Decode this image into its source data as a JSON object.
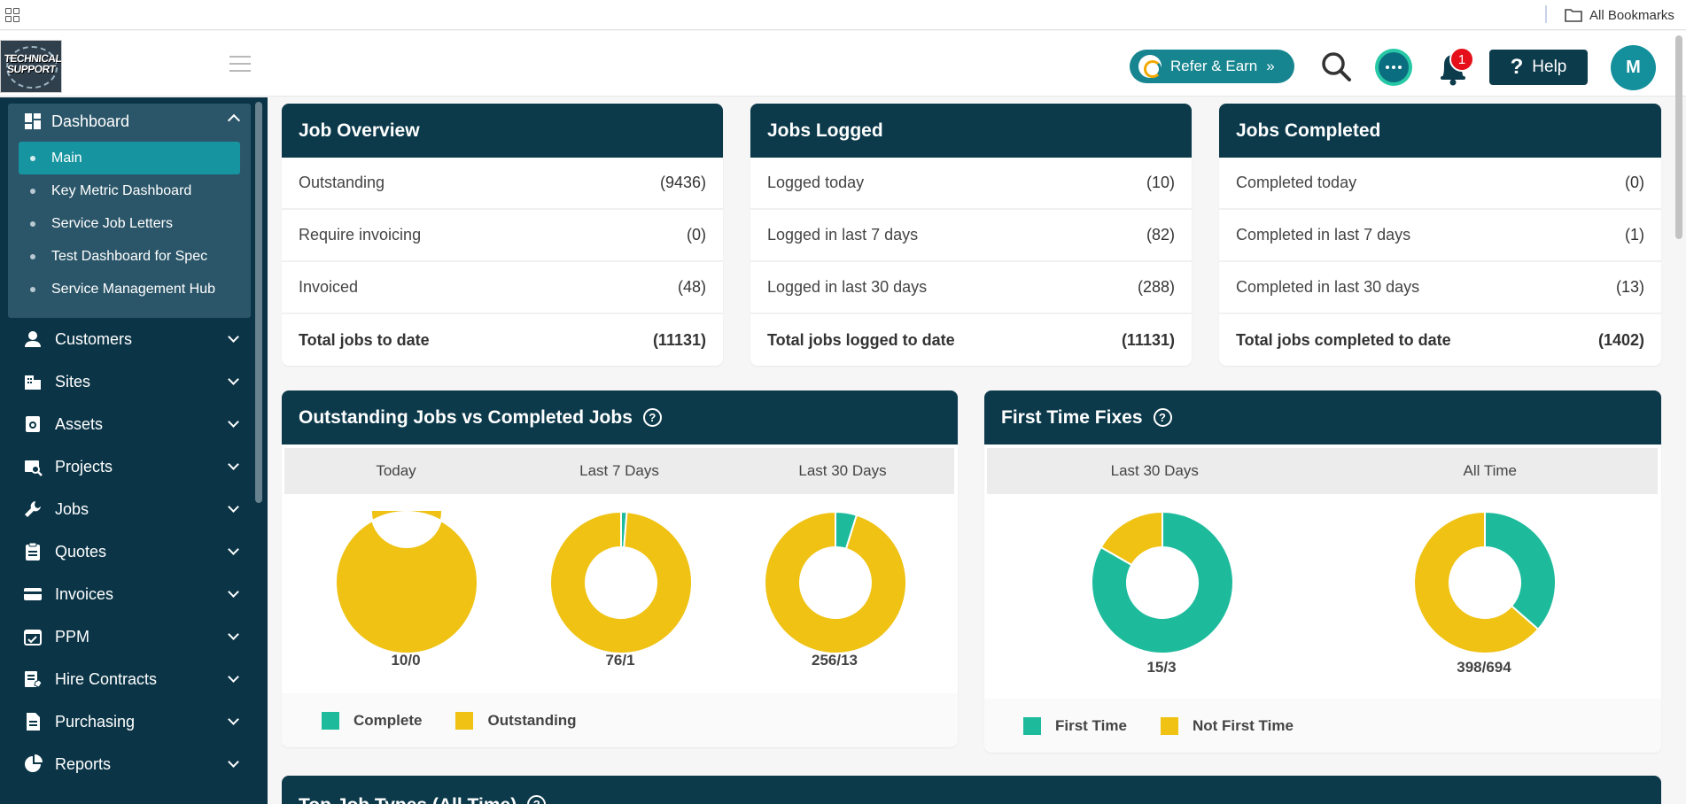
{
  "bookmarks_bar": {
    "folder_label": "All Bookmarks"
  },
  "logo": {
    "line1": "TECHNICAL",
    "line2": "SUPPORT"
  },
  "topbar": {
    "refer_label": "Refer & Earn",
    "refer_chevrons": "»",
    "notification_count": "1",
    "help_label": "Help",
    "help_symbol": "?",
    "avatar_initial": "M"
  },
  "sidebar": {
    "dashboard_label": "Dashboard",
    "dashboard_items": [
      {
        "label": "Main",
        "active": true
      },
      {
        "label": "Key Metric Dashboard"
      },
      {
        "label": "Service Job Letters"
      },
      {
        "label": "Test Dashboard for Spec"
      },
      {
        "label": "Service Management Hub"
      }
    ],
    "nav_items": [
      {
        "label": "Customers",
        "icon": "person-icon"
      },
      {
        "label": "Sites",
        "icon": "building-icon"
      },
      {
        "label": "Assets",
        "icon": "asset-icon"
      },
      {
        "label": "Projects",
        "icon": "projects-icon"
      },
      {
        "label": "Jobs",
        "icon": "wrench-icon"
      },
      {
        "label": "Quotes",
        "icon": "clipboard-icon"
      },
      {
        "label": "Invoices",
        "icon": "card-icon"
      },
      {
        "label": "PPM",
        "icon": "calendar-check-icon"
      },
      {
        "label": "Hire Contracts",
        "icon": "hire-contract-icon"
      },
      {
        "label": "Purchasing",
        "icon": "document-icon"
      },
      {
        "label": "Reports",
        "icon": "pie-chart-icon"
      }
    ]
  },
  "job_overview": {
    "title": "Job Overview",
    "rows": [
      {
        "label": "Outstanding",
        "value": "(9436)"
      },
      {
        "label": "Require invoicing",
        "value": "(0)"
      },
      {
        "label": "Invoiced",
        "value": "(48)"
      }
    ],
    "total": {
      "label": "Total jobs to date",
      "value": "(11131)"
    }
  },
  "jobs_logged": {
    "title": "Jobs Logged",
    "rows": [
      {
        "label": "Logged today",
        "value": "(10)"
      },
      {
        "label": "Logged in last 7 days",
        "value": "(82)"
      },
      {
        "label": "Logged in last 30 days",
        "value": "(288)"
      }
    ],
    "total": {
      "label": "Total jobs logged to date",
      "value": "(11131)"
    }
  },
  "jobs_completed": {
    "title": "Jobs Completed",
    "rows": [
      {
        "label": "Completed today",
        "value": "(0)"
      },
      {
        "label": "Completed in last 7 days",
        "value": "(1)"
      },
      {
        "label": "Completed in last 30 days",
        "value": "(13)"
      }
    ],
    "total": {
      "label": "Total jobs completed to date",
      "value": "(1402)"
    }
  },
  "outstanding_vs_completed": {
    "title": "Outstanding Jobs vs Completed Jobs",
    "periods": [
      "Today",
      "Last 7 Days",
      "Last 30 Days"
    ],
    "legend": [
      "Complete",
      "Outstanding"
    ]
  },
  "first_time_fixes": {
    "title": "First Time Fixes",
    "periods": [
      "Last 30 Days",
      "All Time"
    ],
    "legend": [
      "First Time",
      "Not First Time"
    ]
  },
  "bottom_card": {
    "title": "Top Job Types (All Time)"
  },
  "colors": {
    "complete": "#1dbb9c",
    "outstanding": "#efc214",
    "header": "#0c3a4b",
    "sidebar": "#0b3547",
    "accent": "#1694a0"
  },
  "chart_data": [
    {
      "type": "pie",
      "title": "Outstanding Jobs vs Completed Jobs",
      "subtitle": "Today",
      "labels": [
        "Complete",
        "Outstanding"
      ],
      "values": [
        0,
        10
      ],
      "caption": "10/0"
    },
    {
      "type": "pie",
      "title": "Outstanding Jobs vs Completed Jobs",
      "subtitle": "Last 7 Days",
      "labels": [
        "Complete",
        "Outstanding"
      ],
      "values": [
        1,
        76
      ],
      "caption": "76/1"
    },
    {
      "type": "pie",
      "title": "Outstanding Jobs vs Completed Jobs",
      "subtitle": "Last 30 Days",
      "labels": [
        "Complete",
        "Outstanding"
      ],
      "values": [
        13,
        256
      ],
      "caption": "256/13"
    },
    {
      "type": "pie",
      "title": "First Time Fixes",
      "subtitle": "Last 30 Days",
      "labels": [
        "First Time",
        "Not First Time"
      ],
      "values": [
        15,
        3
      ],
      "caption": "15/3"
    },
    {
      "type": "pie",
      "title": "First Time Fixes",
      "subtitle": "All Time",
      "labels": [
        "First Time",
        "Not First Time"
      ],
      "values": [
        398,
        694
      ],
      "caption": "398/694"
    }
  ]
}
